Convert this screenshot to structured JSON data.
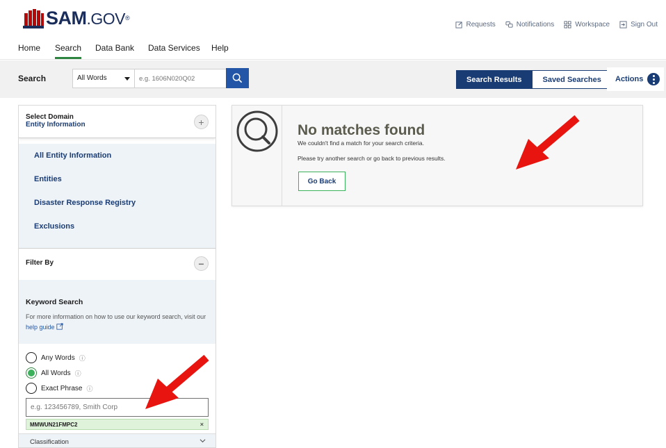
{
  "header": {
    "logo_main": "SAM",
    "logo_gov": ".GOV",
    "logo_reg": "®",
    "util_links": [
      {
        "label": "Requests",
        "icon": "edit-icon"
      },
      {
        "label": "Notifications",
        "icon": "chat-icon"
      },
      {
        "label": "Workspace",
        "icon": "grid-icon"
      },
      {
        "label": "Sign Out",
        "icon": "sign-out-icon"
      }
    ]
  },
  "nav": {
    "items": [
      "Home",
      "Search",
      "Data Bank",
      "Data Services",
      "Help"
    ],
    "active": "Search"
  },
  "search": {
    "label": "Search",
    "mode": "All Words",
    "placeholder": "e.g. 1606N020Q02",
    "results_tab": "Search Results",
    "saved_tab": "Saved Searches",
    "actions_label": "Actions"
  },
  "sidebar": {
    "domain_label": "Select Domain",
    "domain_value": "Entity Information",
    "domains": [
      "All Entity Information",
      "Entities",
      "Disaster Response Registry",
      "Exclusions"
    ],
    "filter_label": "Filter By",
    "keyword_title": "Keyword Search",
    "keyword_help": "For more information on how to use our keyword search, visit our",
    "keyword_link": "help guide",
    "radio_options": [
      "Any Words",
      "All Words",
      "Exact Phrase"
    ],
    "radio_selected": "All Words",
    "keyword_placeholder": "e.g. 123456789, Smith Corp",
    "keyword_chip": "MMWUN21FMPC2",
    "chip_close": "×",
    "classification_label": "Classification"
  },
  "result": {
    "title": "No matches found",
    "subtitle": "We couldn't find a match for your search criteria.",
    "hint": "Please try another search or go back to previous results.",
    "go_back": "Go Back"
  },
  "colors": {
    "brand_navy": "#1a3c74",
    "brand_red": "#b50909",
    "accent_green": "#2e8540",
    "search_blue": "#2356a6",
    "annotation_red": "#e8140f"
  }
}
